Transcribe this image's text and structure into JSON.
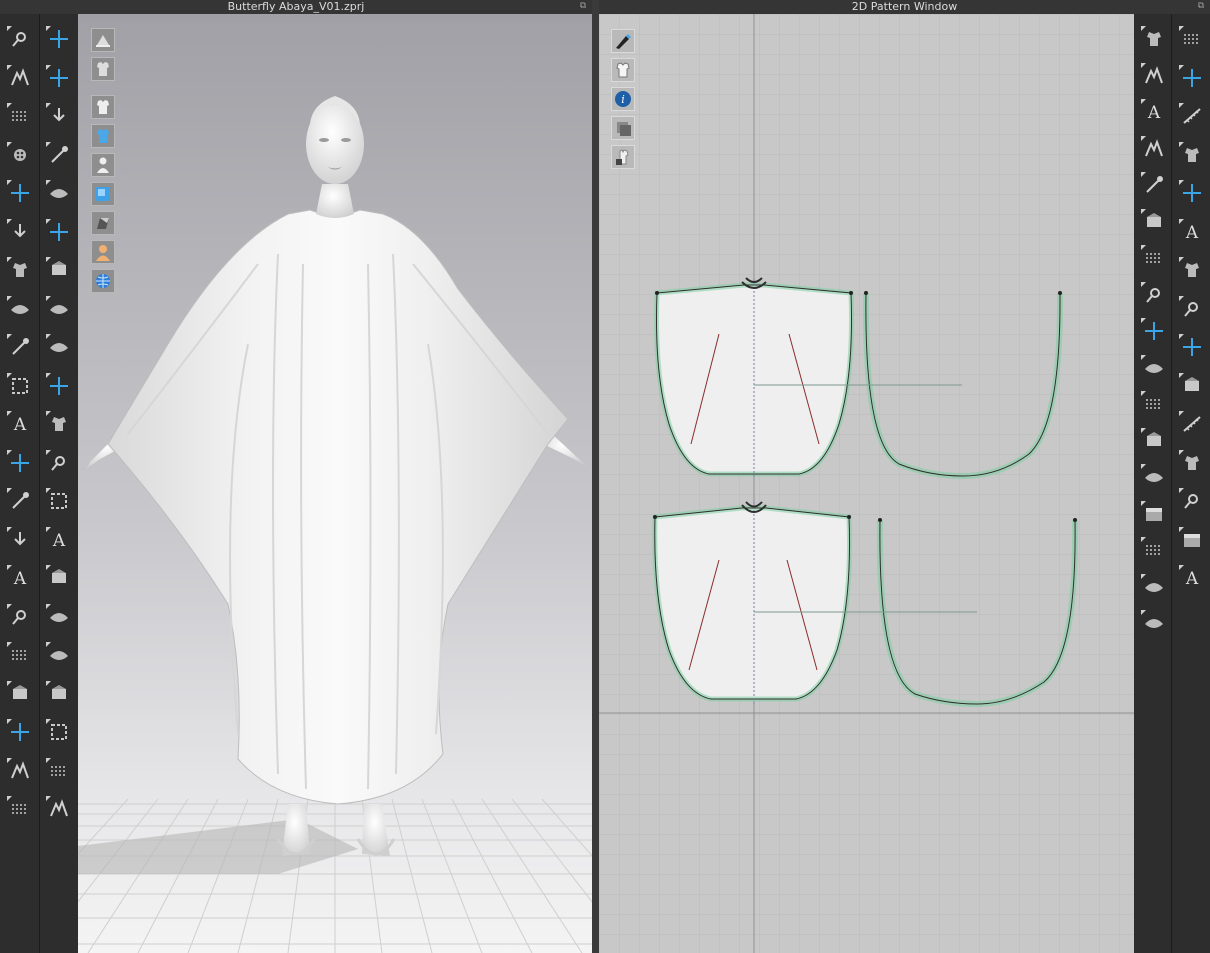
{
  "windows": {
    "left_title": "Butterfly Abaya_V01.zprj",
    "right_title": "2D Pattern Window"
  },
  "left_toolbar_col1": [
    "select-move-icon",
    "transform-pattern-icon",
    "select-mesh-icon",
    "fold-arrangement-icon",
    "tack-icon",
    "tack-pattern-icon",
    "tack-layer-icon",
    "puckering-icon",
    "pin-icon",
    "raycast-pin-icon",
    "fitting-suit-icon",
    "layer-clone-icon",
    "garment-fit-icon",
    "avatar-measure-icon",
    "zipper-icon",
    "button-icon",
    "avatar-pose-icon",
    "tape-measure-icon",
    "line-icon",
    "top-garment-icon",
    "shirt-icon"
  ],
  "left_toolbar_col2": [
    "simulation-icon",
    "steam-icon",
    "select-avatar-icon",
    "fabric-stretch-icon",
    "strengthen-icon",
    "pattern-curve-icon",
    "arrangement-icon",
    "mannequin-icon",
    "fold-icon",
    "measure-icon",
    "bind-icon",
    "button-place-icon",
    "buttonhole-icon",
    "lock-button-icon",
    "zipper-slider-icon",
    "zipper-pull-icon",
    "piping-icon",
    "square-block-icon",
    "gradient-icon",
    "gray-block-icon",
    "spring-icon"
  ],
  "view_3d_overlay": [
    "fabric-display-icon",
    "pattern-display-icon",
    "garment-visible-icon",
    "texture-view-icon",
    "avatar-visible-icon",
    "surface-icon",
    "shade-icon",
    "avatar-skin-icon",
    "environment-icon"
  ],
  "view_2d_overlay": [
    "pattern-tool-icon",
    "garment-icon",
    "info-icon",
    "layer-icon",
    "lock-garment-icon"
  ],
  "right_toolbar_col1": [
    "edit-pattern-icon",
    "transform-pattern-icon",
    "edit-curve-icon",
    "polygon-icon",
    "rectangle-icon",
    "internal-polygon-icon",
    "trace-icon",
    "dart-icon",
    "fold-pattern-icon",
    "internal-rect-icon",
    "sewing-length-icon",
    "segment-sewing-icon",
    "text-pattern-icon",
    "text-edit-icon",
    "grading-icon",
    "auto-sewing-icon",
    "figure-icon"
  ],
  "right_toolbar_col2": [
    "arrange-icon",
    "reset-icon",
    "fold-line-icon",
    "dart-sewing-icon",
    "iron-icon",
    "shirt-fit-icon",
    "fabric-fit-icon",
    "knit-icon",
    "avatar-shirt-icon",
    "line-trace-icon",
    "dashed-line-icon",
    "spring-stitch-icon",
    "elastic-icon",
    "add-layer-icon",
    "puffer-icon"
  ]
}
